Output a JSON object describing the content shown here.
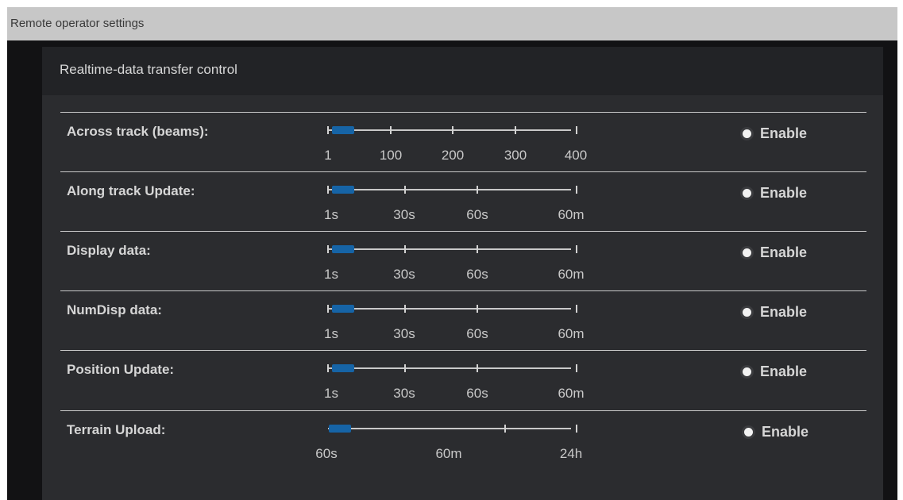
{
  "window": {
    "title": "Remote operator settings"
  },
  "panel": {
    "title": "Realtime-data transfer control"
  },
  "enable_label": "Enable",
  "rows": [
    {
      "label": "Across track (beams):",
      "ticks": [
        "1",
        "100",
        "200",
        "300",
        "400"
      ],
      "value": "1"
    },
    {
      "label": "Along track Update:",
      "ticks": [
        "1s",
        "30s",
        "60s",
        "60m"
      ],
      "value": "1s"
    },
    {
      "label": "Display data:",
      "ticks": [
        "1s",
        "30s",
        "60s",
        "60m"
      ],
      "value": "1s"
    },
    {
      "label": "NumDisp data:",
      "ticks": [
        "1s",
        "30s",
        "60s",
        "60m"
      ],
      "value": "1s"
    },
    {
      "label": "Position Update:",
      "ticks": [
        "1s",
        "30s",
        "60s",
        "60m"
      ],
      "value": "1s"
    },
    {
      "label": "Terrain Upload:",
      "ticks": [
        "60s",
        "60m",
        "24h"
      ],
      "value": "60s"
    }
  ],
  "colors": {
    "handle": "#1664a6",
    "panel": "#2b2c2f",
    "header": "#222326",
    "titlebar": "#c7c7c7"
  }
}
